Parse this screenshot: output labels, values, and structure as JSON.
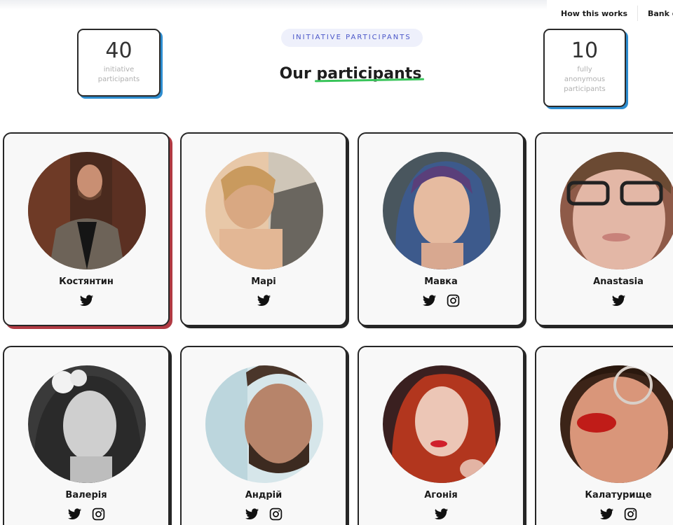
{
  "nav": {
    "how": "How this works",
    "bank": "Bank de"
  },
  "stats": {
    "left": {
      "value": "40",
      "line1": "initiative",
      "line2": "participants"
    },
    "right": {
      "value": "10",
      "line1": "fully",
      "line2": "anonymous",
      "line3": "participants"
    }
  },
  "header": {
    "eyebrow": "INITIATIVE PARTICIPANTS",
    "title_a": "Our",
    "title_b": "participants"
  },
  "accent_colors": {
    "stat_shadow": "#2d8dd0",
    "underline": "#39c45a",
    "eyebrow_text": "#4a56c8",
    "first_card_shadow": "#b13a43"
  },
  "participants": [
    {
      "name": "Костянтин",
      "socials": [
        "twitter-icon"
      ]
    },
    {
      "name": "Марі",
      "socials": [
        "twitter-icon"
      ]
    },
    {
      "name": "Мавка",
      "socials": [
        "twitter-icon",
        "instagram-icon"
      ]
    },
    {
      "name": "Anastasia",
      "socials": [
        "twitter-icon"
      ]
    },
    {
      "name": "Валерія",
      "socials": [
        "twitter-icon",
        "instagram-icon"
      ]
    },
    {
      "name": "Андрій",
      "socials": [
        "twitter-icon",
        "instagram-icon"
      ]
    },
    {
      "name": "Агонія",
      "socials": [
        "twitter-icon"
      ]
    },
    {
      "name": "Калатурище",
      "socials": [
        "twitter-icon",
        "instagram-icon"
      ]
    }
  ]
}
